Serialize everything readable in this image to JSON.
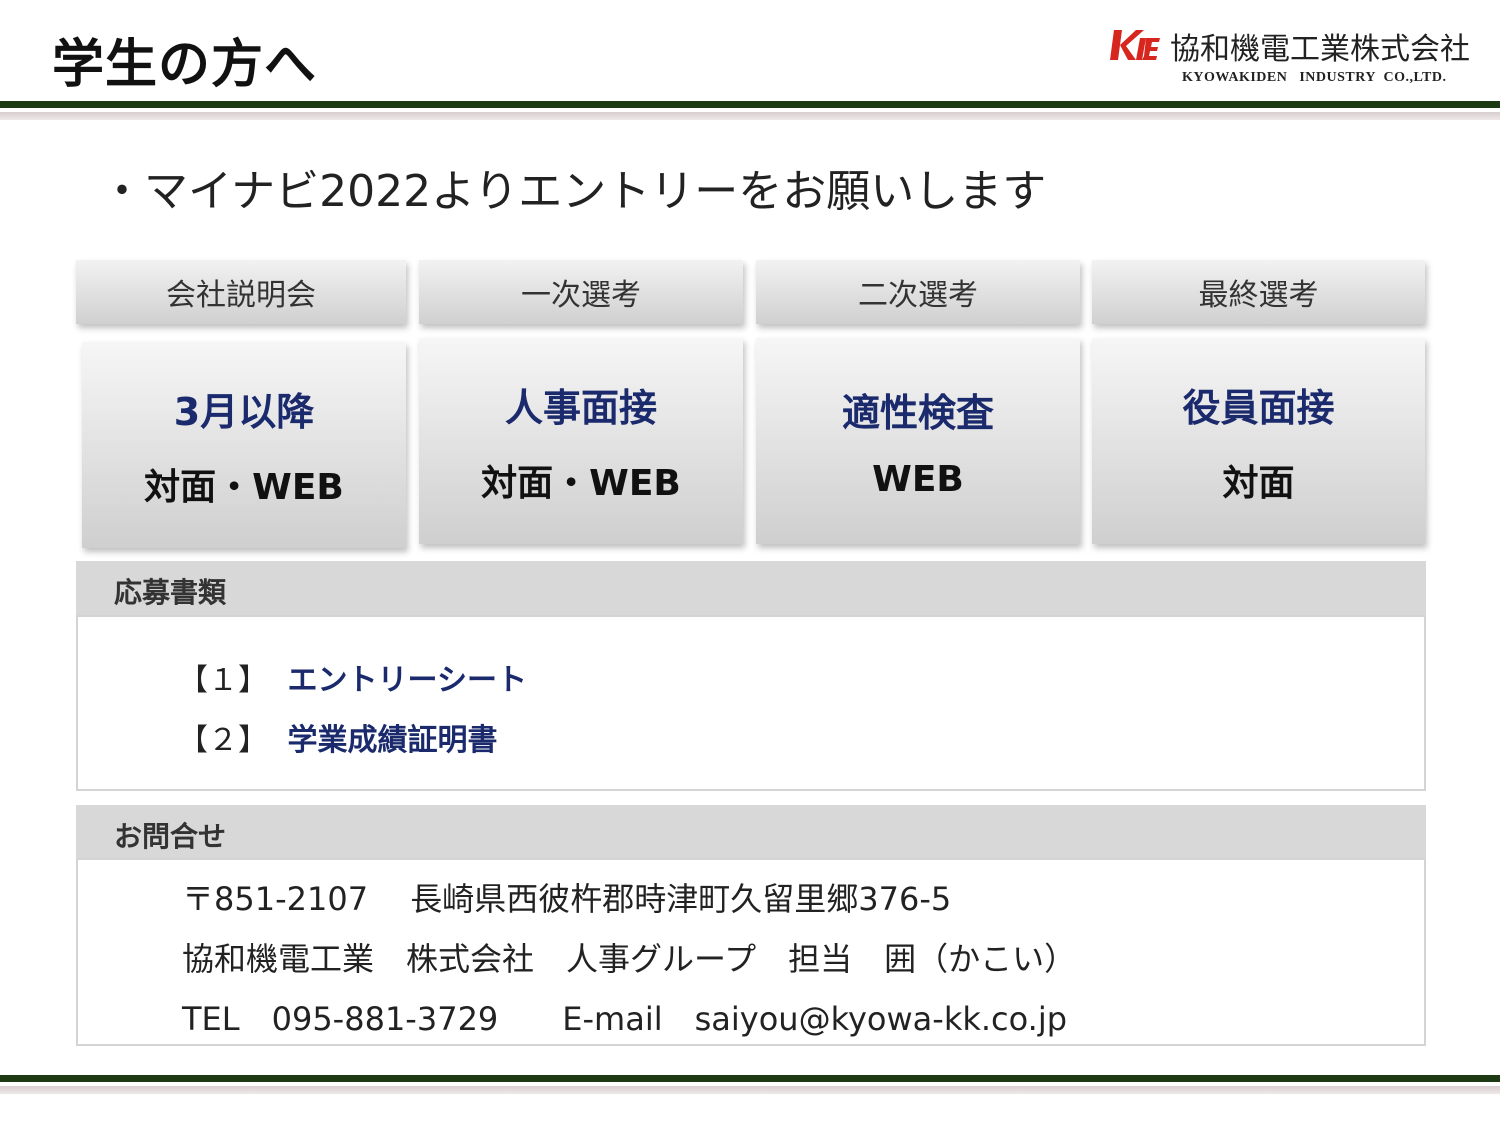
{
  "header": {
    "title": "学生の方へ",
    "company_jp": "協和機電工業株式会社",
    "company_en": "KYOWAKIDEN   INDUSTRY  CO.,LTD.",
    "logo_icon": "kie-logo-icon",
    "logo_color": "#d7261e"
  },
  "intro": "・マイナビ2022よりエントリーをお願いします",
  "stages": [
    {
      "heading": "会社説明会",
      "main": "3月以降",
      "mode": "対面・WEB"
    },
    {
      "heading": "一次選考",
      "main": "人事面接",
      "mode": "対面・WEB"
    },
    {
      "heading": "二次選考",
      "main": "適性検査",
      "mode": "WEB"
    },
    {
      "heading": "最終選考",
      "main": "役員面接",
      "mode": "対面"
    }
  ],
  "documents": {
    "heading": "応募書類",
    "items": [
      {
        "num": "【１】",
        "name": "エントリーシート"
      },
      {
        "num": "【２】",
        "name": "学業成績証明書"
      }
    ]
  },
  "contact": {
    "heading": "お問合せ",
    "address": "〒851-2107　 長崎県西彼杵郡時津町久留里郷376-5",
    "person": "協和機電工業　株式会社　人事グループ　担当　囲（かこい）",
    "tel_email": "TEL　095-881-3729　　E-mail　saiyou@kyowa-kk.co.jp"
  },
  "colors": {
    "accent_navy": "#1a2a6c",
    "rule_green": "#1e3a14"
  }
}
